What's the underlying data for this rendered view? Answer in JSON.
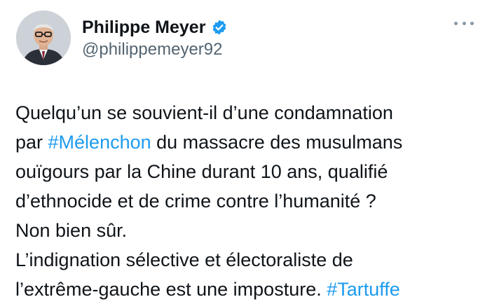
{
  "author": {
    "display_name": "Philippe Meyer",
    "handle": "@philippemeyer92",
    "verified_icon": "verified-badge-icon",
    "verified_color": "#1d9bf0"
  },
  "menu": {
    "icon": "more-options-icon"
  },
  "tweet": {
    "hashtag_color": "#1d9bf0",
    "line1": "Quelqu’un se souvient-il d’une condamnation",
    "line2_pre": "par ",
    "hashtag1": "#Mélenchon",
    "line2_post": " du massacre des musulmans",
    "line3": "ouïgours par la Chine durant 10 ans, qualifié",
    "line4": "d’ethnocide et de crime contre l’humanité ?",
    "line5": "Non bien sûr.",
    "line6": "L’indignation sélective et électoraliste de",
    "line7_pre": "l’extrême-gauche est une imposture. ",
    "hashtag2": "#Tartuffe"
  }
}
